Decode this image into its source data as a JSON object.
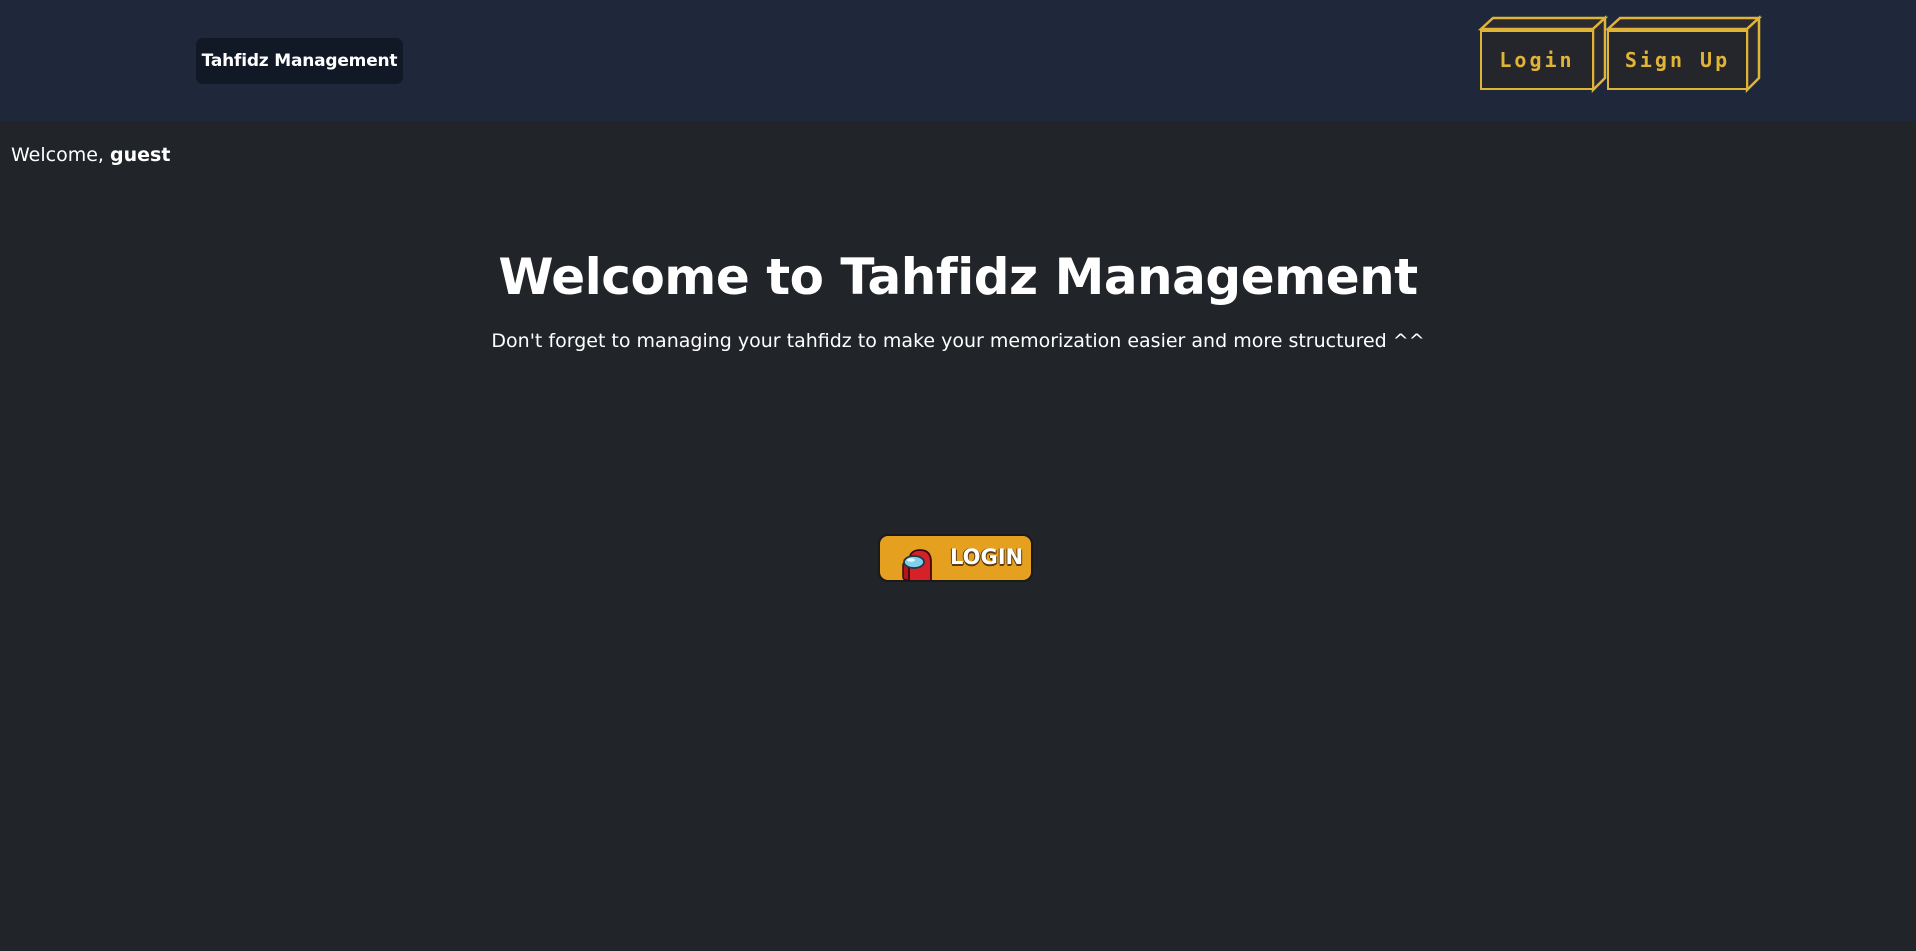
{
  "navbar": {
    "brand": "Tahfidz Management",
    "login_label": "Login",
    "signup_label": "Sign Up"
  },
  "greeting": {
    "prefix": "Welcome,",
    "user": "guest"
  },
  "hero": {
    "title": "Welcome to Tahfidz Management",
    "subtitle": "Don't forget to managing your tahfidz to make your memorization easier and more structured ^^",
    "cta_label": "LOGIN",
    "cta_icon": "crewmate-icon"
  },
  "colors": {
    "page_bg": "#212429",
    "navbar_bg": "#1f283a",
    "brand_bg": "#111826",
    "accent_gold": "#e0b437",
    "cta_orange": "#e6a020"
  }
}
